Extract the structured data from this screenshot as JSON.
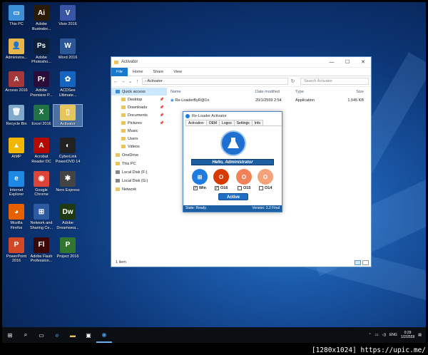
{
  "desktop": {
    "icons": [
      {
        "label": "This PC",
        "icon": "computer-icon",
        "color": "#3b8ed8",
        "glyph": "▭"
      },
      {
        "label": "Adobe\nIllustrator...",
        "icon": "illustrator-icon",
        "color": "#2b1a05",
        "glyph": "Ai"
      },
      {
        "label": "Visio 2016",
        "icon": "visio-icon",
        "color": "#3955a3",
        "glyph": "V"
      },
      {
        "label": "Administra...",
        "icon": "user-folder-icon",
        "color": "#e8b64a",
        "glyph": "👤"
      },
      {
        "label": "Adobe\nPhotosho...",
        "icon": "photoshop-icon",
        "color": "#0b1f3a",
        "glyph": "Ps"
      },
      {
        "label": "Word 2016",
        "icon": "word-icon",
        "color": "#2b5797",
        "glyph": "W"
      },
      {
        "label": "Access 2016",
        "icon": "access-icon",
        "color": "#a4373a",
        "glyph": "A"
      },
      {
        "label": "Adobe\nPremiere P...",
        "icon": "premiere-icon",
        "color": "#2a0c3a",
        "glyph": "Pr"
      },
      {
        "label": "ACDSee\nUltimate...",
        "icon": "acdsee-icon",
        "color": "#1565c0",
        "glyph": "✿"
      },
      {
        "label": "Recycle Bin",
        "icon": "recycle-bin-icon",
        "color": "#7fa8c9",
        "glyph": "🗑"
      },
      {
        "label": "Excel 2016",
        "icon": "excel-icon",
        "color": "#217346",
        "glyph": "X"
      },
      {
        "label": "Activator",
        "icon": "activator-folder-icon",
        "color": "#e6c55c",
        "glyph": "▯"
      },
      {
        "label": "AIMP",
        "icon": "aimp-icon",
        "color": "#f2b705",
        "glyph": "▲"
      },
      {
        "label": "Acrobat\nReader DC",
        "icon": "acrobat-icon",
        "color": "#b30b00",
        "glyph": "A"
      },
      {
        "label": "CyberLink\nPowerDVD 14",
        "icon": "powerdvd-icon",
        "color": "#222",
        "glyph": "◐"
      },
      {
        "label": "Internet\nExplorer",
        "icon": "ie-icon",
        "color": "#1e88e5",
        "glyph": "e"
      },
      {
        "label": "Google\nChrome",
        "icon": "chrome-icon",
        "color": "#db4437",
        "glyph": "◉"
      },
      {
        "label": "Nero Express",
        "icon": "nero-icon",
        "color": "#444",
        "glyph": "✱"
      },
      {
        "label": "Mozilla\nFirefox",
        "icon": "firefox-icon",
        "color": "#e66000",
        "glyph": "◕"
      },
      {
        "label": "Network and\nSharing Ce...",
        "icon": "network-icon",
        "color": "#2c5aa0",
        "glyph": "⊞"
      },
      {
        "label": "Adobe\nDreamwea...",
        "icon": "dreamweaver-icon",
        "color": "#1f3a10",
        "glyph": "Dw"
      },
      {
        "label": "PowerPoint\n2016",
        "icon": "powerpoint-icon",
        "color": "#d24726",
        "glyph": "P"
      },
      {
        "label": "Adobe Flash\nProfession...",
        "icon": "flash-icon",
        "color": "#3a0606",
        "glyph": "Fl"
      },
      {
        "label": "Project 2016",
        "icon": "project-icon",
        "color": "#31752f",
        "glyph": "P"
      }
    ]
  },
  "explorer": {
    "title": "Activator",
    "ribbon_tabs": [
      "File",
      "Home",
      "Share",
      "View"
    ],
    "path": "Activator",
    "search_placeholder": "Search Activator",
    "nav": [
      {
        "label": "Quick access",
        "sub": false,
        "active": true,
        "pin": false,
        "icon": "star-icon"
      },
      {
        "label": "Desktop",
        "sub": true,
        "active": false,
        "pin": true,
        "icon": "desktop-icon"
      },
      {
        "label": "Downloads",
        "sub": true,
        "active": false,
        "pin": true,
        "icon": "downloads-icon"
      },
      {
        "label": "Documents",
        "sub": true,
        "active": false,
        "pin": true,
        "icon": "documents-icon"
      },
      {
        "label": "Pictures",
        "sub": true,
        "active": false,
        "pin": true,
        "icon": "pictures-icon"
      },
      {
        "label": "Music",
        "sub": true,
        "active": false,
        "pin": false,
        "icon": "music-icon"
      },
      {
        "label": "Users",
        "sub": true,
        "active": false,
        "pin": false,
        "icon": "folder-icon"
      },
      {
        "label": "Videos",
        "sub": true,
        "active": false,
        "pin": false,
        "icon": "videos-icon"
      },
      {
        "label": "",
        "sub": false,
        "active": false,
        "pin": false,
        "icon": ""
      },
      {
        "label": "OneDrive",
        "sub": false,
        "active": false,
        "pin": false,
        "icon": "onedrive-icon"
      },
      {
        "label": "",
        "sub": false,
        "active": false,
        "pin": false,
        "icon": ""
      },
      {
        "label": "This PC",
        "sub": false,
        "active": false,
        "pin": false,
        "icon": "computer-icon"
      },
      {
        "label": "",
        "sub": false,
        "active": false,
        "pin": false,
        "icon": ""
      },
      {
        "label": "Local Disk (F:)",
        "sub": false,
        "active": false,
        "pin": false,
        "icon": "drive-icon"
      },
      {
        "label": "",
        "sub": false,
        "active": false,
        "pin": false,
        "icon": ""
      },
      {
        "label": "Local Disk (G:)",
        "sub": false,
        "active": false,
        "pin": false,
        "icon": "drive-icon"
      },
      {
        "label": "",
        "sub": false,
        "active": false,
        "pin": false,
        "icon": ""
      },
      {
        "label": "Network",
        "sub": false,
        "active": false,
        "pin": false,
        "icon": "network-icon"
      }
    ],
    "columns": [
      "Name",
      "Date modified",
      "Type",
      "Size"
    ],
    "rows": [
      {
        "name": "Re-LoaderByR@1n",
        "date": "20/1/2559 2:54",
        "type": "Application",
        "size": "1,545 KB"
      }
    ],
    "status": "1 item"
  },
  "reloader": {
    "title": "Re-Loader Activator",
    "tabs": [
      "Activation",
      "OEM",
      "Logos",
      "Settings",
      "Info"
    ],
    "hello": "Hello, Administrator",
    "products": [
      {
        "label": "Win",
        "glyph": "⊞",
        "color": "#1e7be0",
        "checked": true
      },
      {
        "label": "O16",
        "glyph": "O",
        "color": "#d83b01",
        "checked": true
      },
      {
        "label": "O15",
        "glyph": "O",
        "color": "#f0825a",
        "checked": false
      },
      {
        "label": "O14",
        "glyph": "O",
        "color": "#f4a27a",
        "checked": false
      }
    ],
    "active_label": "Active",
    "state": "State: Ready.",
    "version": "Version: 2.2 Final"
  },
  "taskbar": {
    "lang": "ENG",
    "time": "0:29",
    "date": "1/2/2559"
  },
  "caption": "[1280x1024] https://upic.me/"
}
